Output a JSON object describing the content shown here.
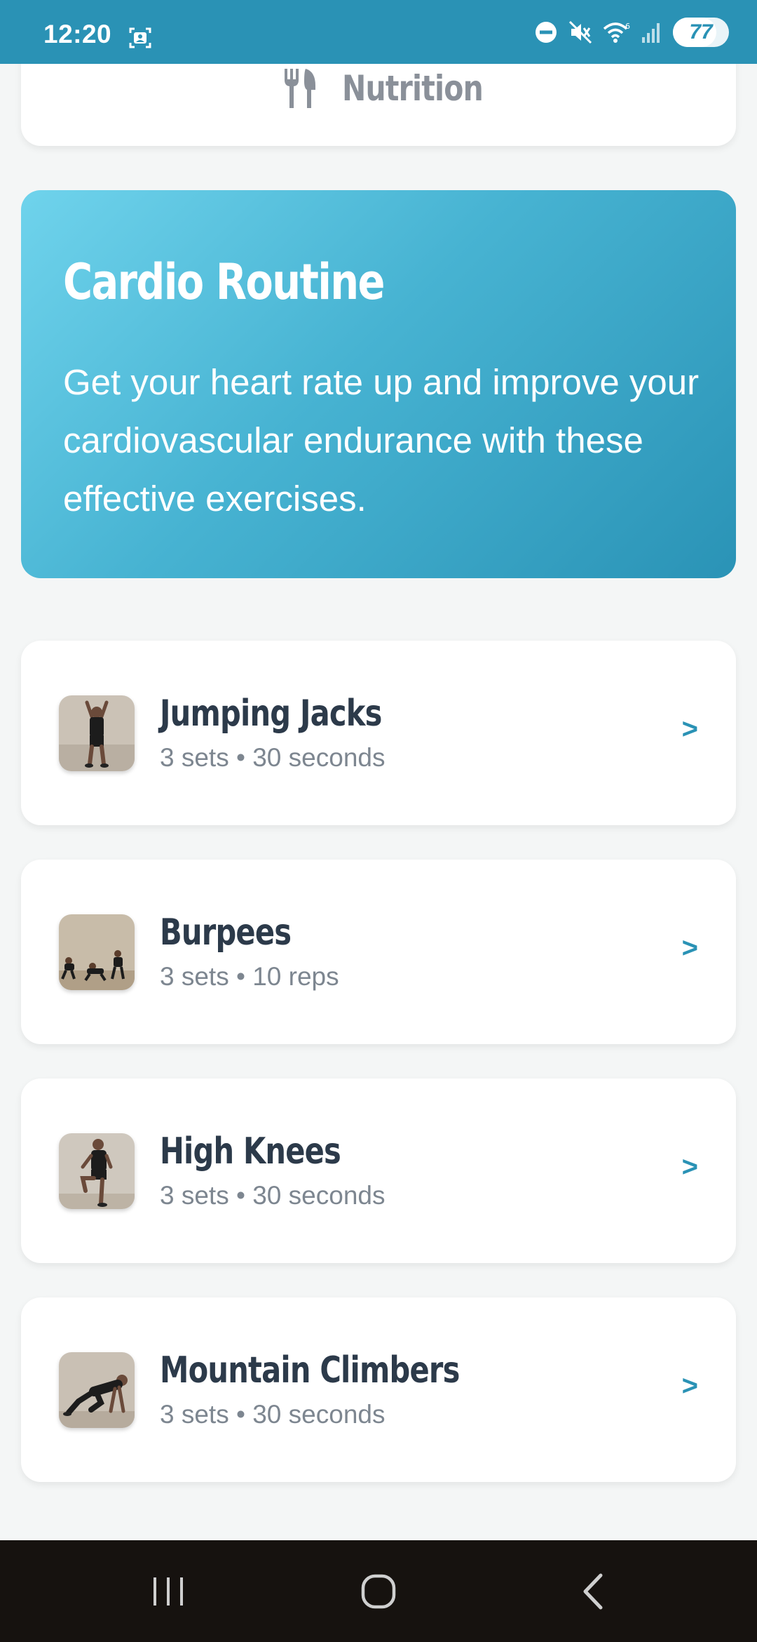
{
  "status_bar": {
    "time": "12:20",
    "battery": "77",
    "battery_level": 0.77,
    "background_color": "#2a92b5",
    "icons": [
      "screenshot-icon",
      "do-not-disturb-icon",
      "mute-icon",
      "wifi-icon",
      "signal-icon",
      "battery-icon"
    ]
  },
  "nutrition": {
    "label": "Nutrition",
    "icon": "fork-knife-icon"
  },
  "hero": {
    "title": "Cardio Routine",
    "description": "Get your heart rate up and improve your cardiovascular endurance with these effective exercises.",
    "gradient_start": "#6fd3ec",
    "gradient_end": "#2a93b6"
  },
  "exercises": [
    {
      "name": "Jumping Jacks",
      "detail": "3 sets • 30 seconds",
      "chevron": ">"
    },
    {
      "name": "Burpees",
      "detail": "3 sets • 10 reps",
      "chevron": ">"
    },
    {
      "name": "High Knees",
      "detail": "3 sets • 30 seconds",
      "chevron": ">"
    },
    {
      "name": "Mountain Climbers",
      "detail": "3 sets • 30 seconds",
      "chevron": ">"
    }
  ],
  "nav_bar": {
    "buttons": [
      "recent-apps-icon",
      "home-icon",
      "back-icon"
    ]
  },
  "colors": {
    "accent": "#2a92b5",
    "title_text": "#2c3a4a",
    "subtitle_text": "#7d8690",
    "nav_background": "#16120f"
  }
}
